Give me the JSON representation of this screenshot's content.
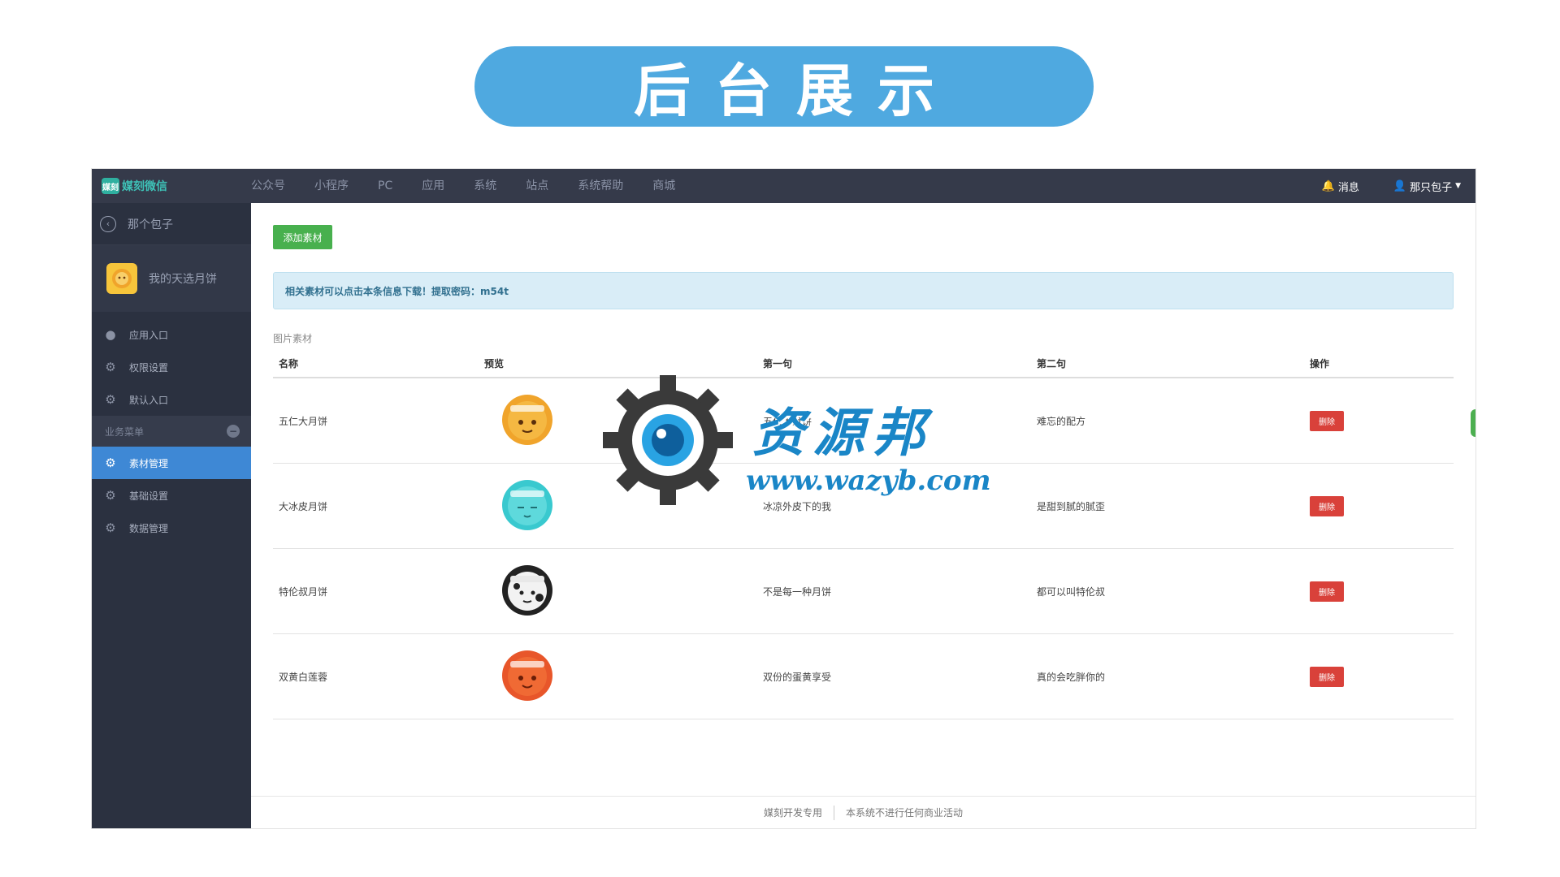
{
  "banner": {
    "title": "后台展示"
  },
  "topbar": {
    "logo_badge": "媒刻",
    "logo_text": "媒刻微信",
    "nav": [
      "公众号",
      "小程序",
      "PC",
      "应用",
      "系统",
      "站点",
      "系统帮助",
      "商城"
    ],
    "messages": "消息",
    "user": "那只包子"
  },
  "sidebar": {
    "back_label": "那个包子",
    "account_name": "我的天选月饼",
    "items_top": [
      "应用入口",
      "权限设置",
      "默认入口"
    ],
    "section_label": "业务菜单",
    "items_biz": [
      "素材管理",
      "基础设置",
      "数据管理"
    ],
    "active": "素材管理"
  },
  "content": {
    "add_button": "添加素材",
    "alert": "相关素材可以点击本条信息下载！提取密码：m54t",
    "section_label": "图片素材",
    "columns": [
      "名称",
      "预览",
      "第一句",
      "第二句",
      "操作"
    ],
    "rows": [
      {
        "name": "五仁大月饼",
        "first": "五仁大月饼",
        "second": "难忘的配方",
        "action": "删除",
        "color": "#f0a42b",
        "face": "#f5b842"
      },
      {
        "name": "大冰皮月饼",
        "first": "冰凉外皮下的我",
        "second": "是甜到腻的腻歪",
        "action": "删除",
        "color": "#39c9cf",
        "face": "#5ed9dc"
      },
      {
        "name": "特伦叔月饼",
        "first": "不是每一种月饼",
        "second": "都可以叫特伦叔",
        "action": "删除",
        "color": "#222222",
        "face": "#f2f2f2"
      },
      {
        "name": "双黄白莲蓉",
        "first": "双份的蛋黄享受",
        "second": "真的会吃胖你的",
        "action": "删除",
        "color": "#e8562a",
        "face": "#f06a34"
      }
    ]
  },
  "footer": {
    "left": "媒刻开发专用",
    "right": "本系统不进行任何商业活动"
  },
  "watermark": {
    "line1": "资源邦",
    "line2": "www.wazyb.com"
  },
  "colors": {
    "banner": "#4fa9e0",
    "topbar": "#353a4a",
    "sidebar": "#2b3140",
    "active": "#3e88d5",
    "add": "#48b04e",
    "delete": "#d9413a"
  }
}
